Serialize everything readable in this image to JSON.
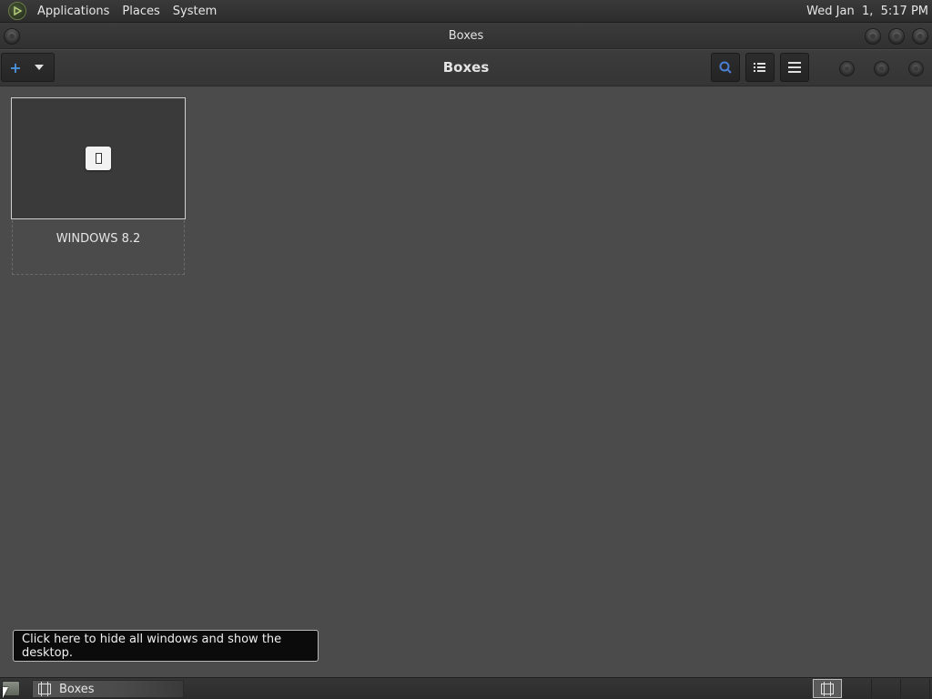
{
  "top_panel": {
    "menus": [
      "Applications",
      "Places",
      "System"
    ],
    "clock": "Wed Jan  1,  5:17 PM"
  },
  "window": {
    "title": "Boxes"
  },
  "headerbar": {
    "title": "Boxes",
    "new_icon": "plus-icon",
    "new_dropdown_icon": "chevron-down-icon",
    "search_icon": "search-icon",
    "selection_icon": "list-icon",
    "menu_icon": "hamburger-menu-icon"
  },
  "boxes": [
    {
      "name": "WINDOWS 8.2",
      "icon": "vm-placeholder-icon"
    }
  ],
  "tooltip": {
    "text": "Click here to hide all windows and show the desktop."
  },
  "taskbar": {
    "tasks": [
      {
        "label": "Boxes",
        "icon": "boxes-app-icon"
      }
    ]
  },
  "colors": {
    "accent": "#4a90d9",
    "background": "#4b4b4b",
    "panel": "#2c2c2c"
  }
}
